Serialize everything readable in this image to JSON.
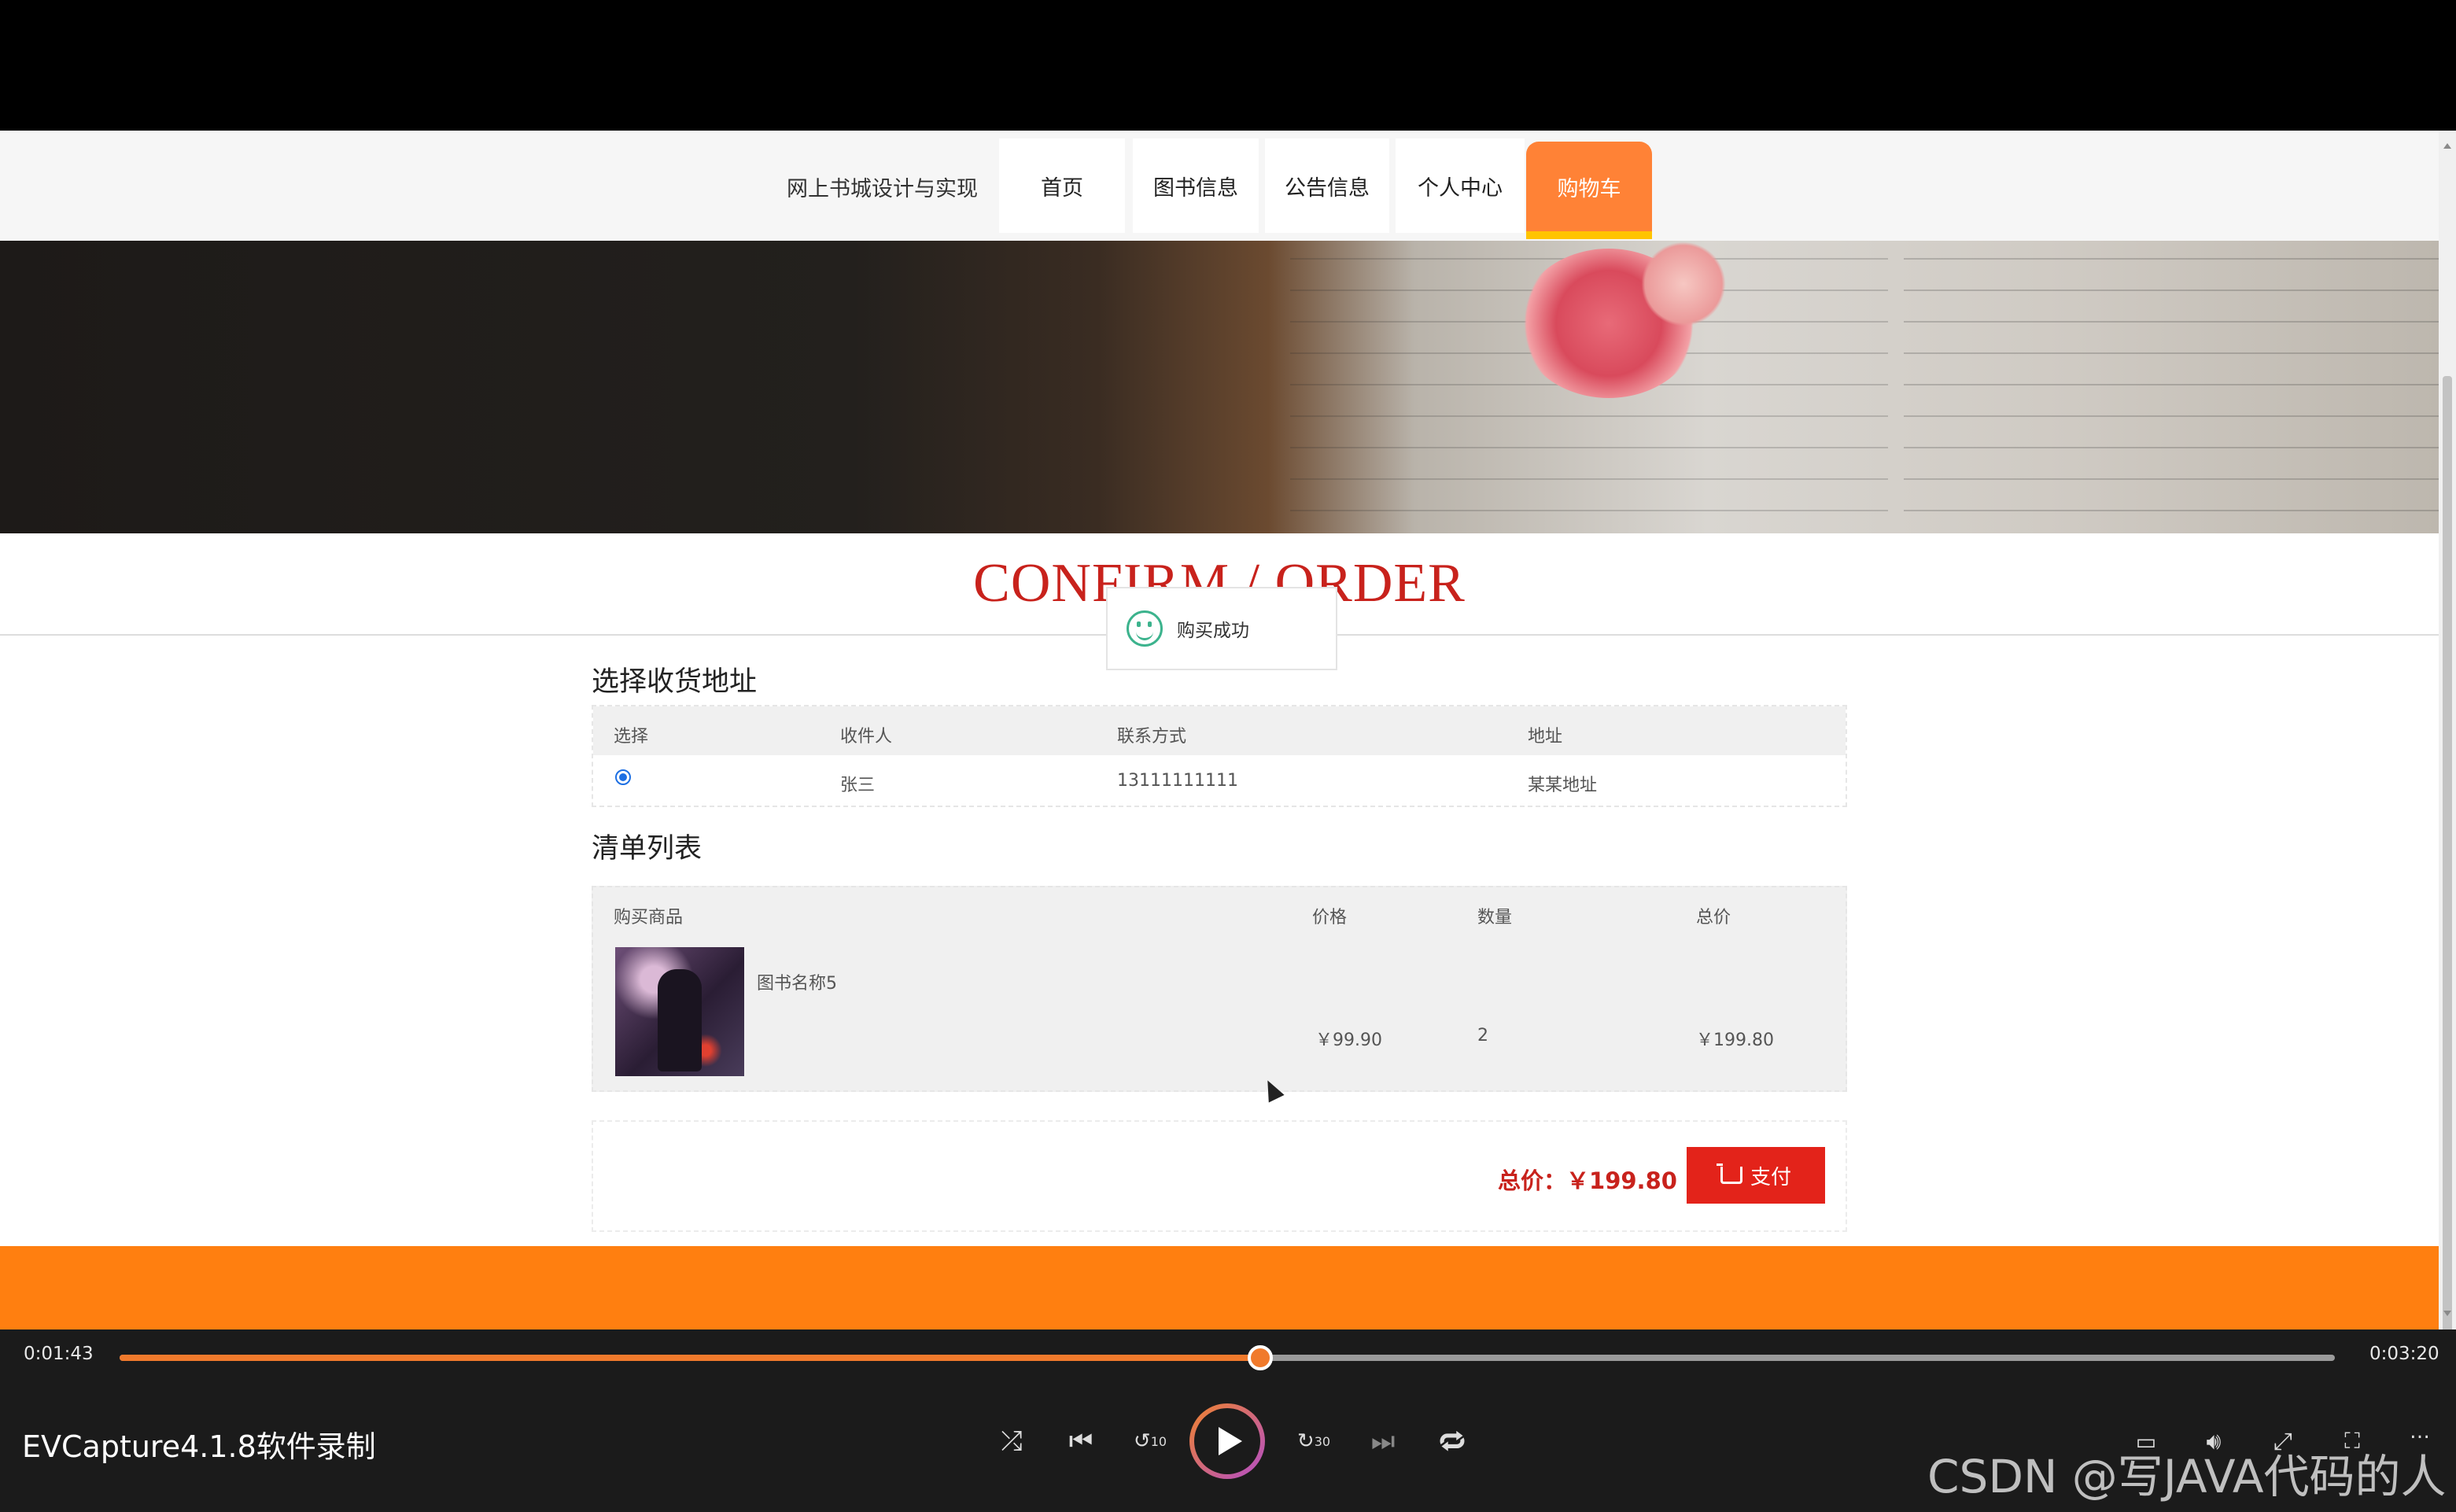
{
  "site": {
    "brand": "网上书城设计与实现",
    "nav": [
      "首页",
      "图书信息",
      "公告信息",
      "个人中心",
      "购物车"
    ],
    "active_nav": "购物车",
    "page_title": "CONFIRM / ORDER"
  },
  "toast": {
    "message": "购买成功",
    "icon": "smile-icon"
  },
  "address_section": {
    "heading": "选择收货地址",
    "columns": [
      "选择",
      "收件人",
      "联系方式",
      "地址"
    ],
    "rows": [
      {
        "selected": true,
        "recipient": "张三",
        "phone": "13111111111",
        "address": "某某地址"
      }
    ]
  },
  "items_section": {
    "heading": "清单列表",
    "columns": [
      "购买商品",
      "价格",
      "数量",
      "总价"
    ],
    "rows": [
      {
        "name": "图书名称5",
        "price": "￥99.90",
        "quantity": "2",
        "total": "￥199.80"
      }
    ]
  },
  "summary": {
    "label": "总价：",
    "amount": "￥199.80",
    "pay_label": "支付"
  },
  "player": {
    "elapsed": "0:01:43",
    "duration": "0:03:20",
    "progress": 0.515,
    "title": "EVCapture4.1.8软件录制",
    "controls": [
      "shuffle-icon",
      "skip-previous-icon",
      "rewind-10-icon",
      "play-icon",
      "forward-30-icon",
      "skip-next-icon",
      "repeat-icon",
      "subtitles-icon",
      "volume-icon",
      "expand-icon",
      "fullscreen-icon",
      "more-icon"
    ],
    "rewind_label": "10",
    "forward_label": "30"
  },
  "watermark": "CSDN @写JAVA代码的人",
  "colors": {
    "accent": "#ff8236",
    "price_red": "#c8221c",
    "pay_button": "#e3231a",
    "footer_band": "#ff7f10",
    "progress": "#f07a2c"
  }
}
